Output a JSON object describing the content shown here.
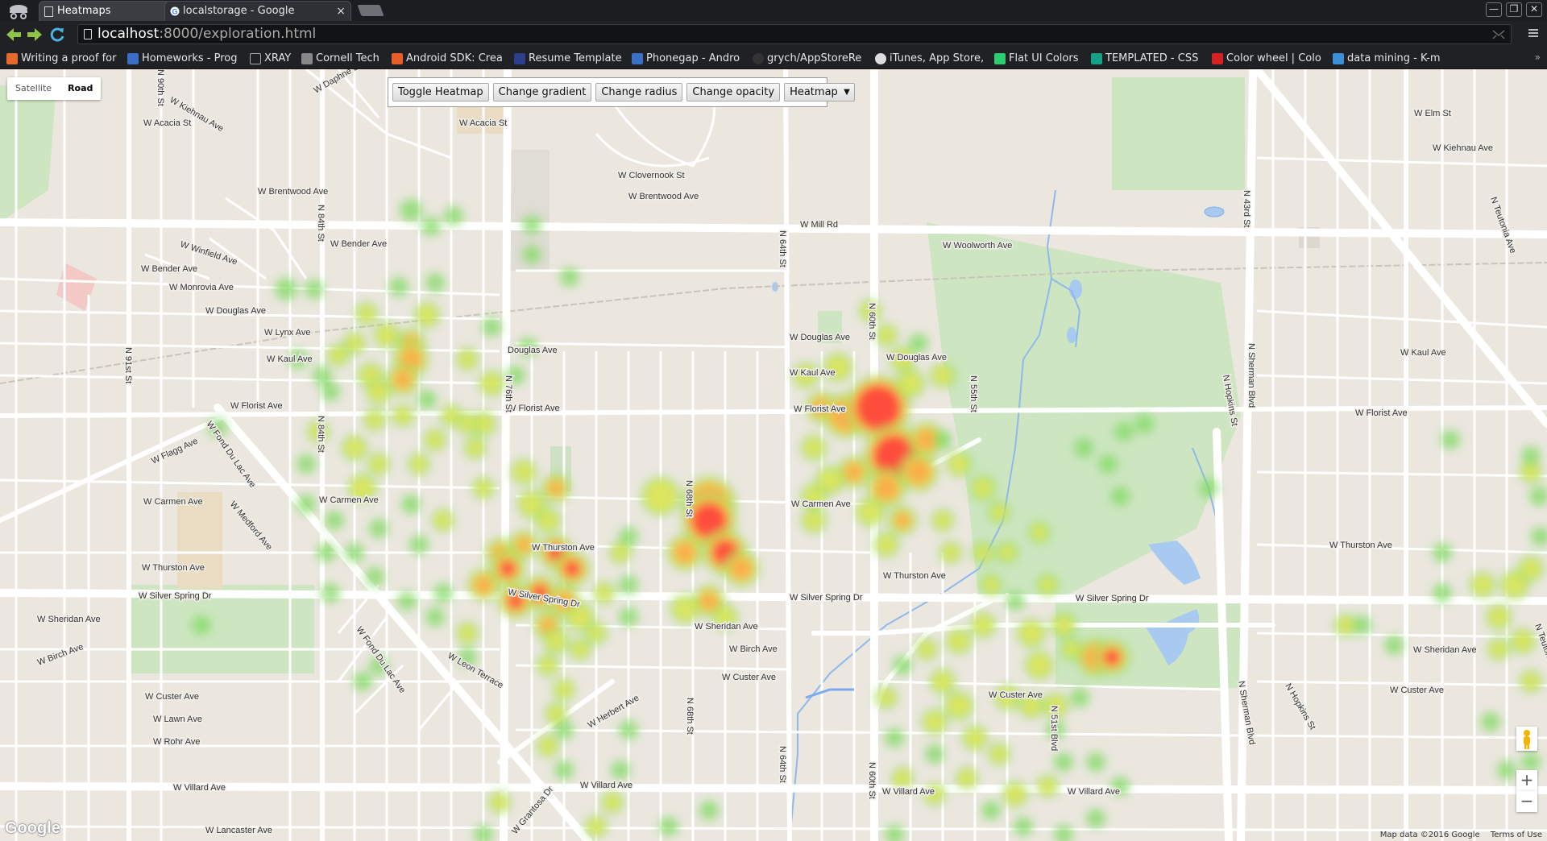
{
  "tabs": [
    {
      "title": "Heatmaps",
      "active": true,
      "close": "×"
    },
    {
      "title": "localstorage - Google",
      "active": false,
      "close": "×"
    }
  ],
  "window_controls": [
    "—",
    "❐",
    "✕"
  ],
  "address": {
    "host": "localhost",
    "path": ":8000/exploration.html"
  },
  "bookmarks": [
    {
      "label": "Writing a proof for",
      "icon_color": "#e66a2c"
    },
    {
      "label": "Homeworks - Prog",
      "icon_color": "#3b6fc6"
    },
    {
      "label": "XRAY",
      "icon_color": "#777777"
    },
    {
      "label": "Cornell Tech",
      "icon_color": "#888888"
    },
    {
      "label": "Android SDK: Crea",
      "icon_color": "#e85d28"
    },
    {
      "label": "Resume Template",
      "icon_color": "#2c3e8c"
    },
    {
      "label": "Phonegap - Andro",
      "icon_color": "#3b6fc6"
    },
    {
      "label": "grych/AppStoreRe",
      "icon_color": "#333333"
    },
    {
      "label": "iTunes, App Store,",
      "icon_color": "#dddddd"
    },
    {
      "label": "Flat UI Colors",
      "icon_color": "#2ecc71"
    },
    {
      "label": "TEMPLATED - CSS",
      "icon_color": "#16a085"
    },
    {
      "label": "Color wheel | Colo",
      "icon_color": "#d22222"
    },
    {
      "label": "data mining - K-m",
      "icon_color": "#3b8fd6"
    }
  ],
  "map_type": {
    "satellite": "Satellite",
    "road": "Road"
  },
  "controls": {
    "toggle": "Toggle Heatmap",
    "gradient": "Change gradient",
    "radius": "Change radius",
    "opacity": "Change opacity",
    "mode": "Heatmap",
    "caret": "▼"
  },
  "attribution": {
    "data": "Map data ©2016 Google",
    "terms": "Terms of Use"
  },
  "logo": "Google",
  "zoom": {
    "in": "+",
    "out": "−"
  },
  "streets": {
    "mill": "W Mill Rd",
    "woolworth": "W Woolworth Ave",
    "florist_w": "W Florist Ave",
    "florist_c": "W Florist Ave",
    "florist_e": "W Florist Ave",
    "florist_e2": "W Florist Ave",
    "carmen_w": "W Carmen Ave",
    "carmen_c": "W Carmen Ave",
    "carmen_e": "W Carmen Ave",
    "thurston_w": "W Thurston Ave",
    "thurston_c": "W Thurston Ave",
    "thurston_e": "W Thurston Ave",
    "thurston_e2": "W Thurston Ave",
    "silver_w": "W Silver Spring Dr",
    "silver_c": "W Silver Spring Dr",
    "silver_e": "W Silver Spring Dr",
    "silver_e2": "W Silver Spring Dr",
    "villard_w": "W Villard Ave",
    "villard_c": "W Villard Ave",
    "villard_e": "W Villard Ave",
    "villard_e2": "W Villard Ave",
    "custer_w": "W Custer Ave",
    "custer_c": "W Custer Ave",
    "custer_e": "W Custer Ave",
    "custer_e2": "W Custer Ave",
    "sheridan_w": "W Sheridan Ave",
    "sheridan_c": "W Sheridan Ave",
    "sheridan_e": "W Sheridan Ave",
    "douglas_w": "W Douglas Ave",
    "douglas_c": "W Douglas Ave",
    "douglas_e": "W Douglas Ave",
    "douglas_mid": "Douglas Ave",
    "kaul_w": "W Kaul Ave",
    "kaul_c": "W Kaul Ave",
    "kaul_e": "W Kaul Ave",
    "brentwood_w": "W Brentwood Ave",
    "brentwood_c": "W Brentwood Ave",
    "acacia_w": "W Acacia St",
    "acacia_c": "W Acacia St",
    "clovernook": "W Clovernook St",
    "winfield": "W Winfield Ave",
    "bender": "W Bender Ave",
    "bender2": "W Bender Ave",
    "monrovia": "W Monrovia Ave",
    "lynx": "W Lynx Ave",
    "birch_w": "W Birch Ave",
    "birch_c": "W Birch Ave",
    "lawn": "W Lawn Ave",
    "rohr": "W Rohr Ave",
    "lancaster": "W Lancaster Ave",
    "elm": "W Elm St",
    "kiehnau_e": "W Kiehnau Ave",
    "kiehnau_w": "W Kiehnau Ave",
    "daphne": "W Daphne St",
    "flagg": "W Flagg Ave",
    "fond_du_lac": "W Fond Du Lac Ave",
    "fond_du_lac2": "W Fond Du Lac Ave",
    "medford": "W Medford Ave",
    "leon": "W Leon Terrace",
    "herbert": "W Herbert Ave",
    "grantosa": "W Grantosa Dr",
    "sherman": "N Sherman Blvd",
    "sherman2": "N Sherman Blvd",
    "teutonia": "N Teutonia Ave",
    "teutonia2": "N Teutonia Ave",
    "hopkins": "N Hopkins St",
    "hopkins2": "N Hopkins St",
    "n60": "N 60th St",
    "n60b": "N 60th St",
    "n64": "N 64th St",
    "n64b": "N 64th St",
    "n68": "N 68th St",
    "n68b": "N 68th St",
    "n76": "N 76th St",
    "n84": "N 84th St",
    "n84b": "N 84th St",
    "n91": "N 91st St",
    "n90": "N 90th St",
    "n43": "N 43rd St",
    "n55": "N 55th St",
    "n51": "N 51st Blvd"
  }
}
